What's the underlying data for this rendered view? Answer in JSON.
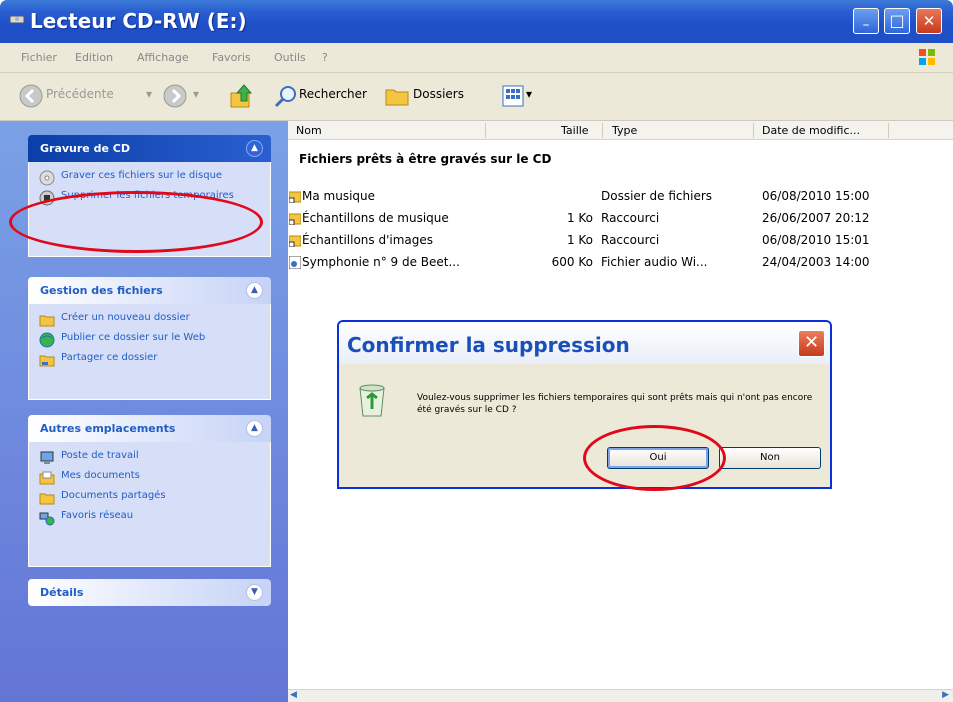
{
  "window": {
    "title": "Lecteur CD-RW (E:)",
    "minimize": "_",
    "maximize": "□",
    "close": "✕"
  },
  "menu": [
    "Fichier",
    "Edition",
    "Affichage",
    "Favoris",
    "Outils",
    "?"
  ],
  "toolbar": {
    "back": "Précédente",
    "search": "Rechercher",
    "folders": "Dossiers"
  },
  "left": {
    "cd_burning": {
      "title": "Gravure de CD",
      "items": [
        "Graver ces fichiers sur le disque",
        "Supprimer les fichiers temporaires"
      ]
    },
    "file_management": {
      "title": "Gestion des fichiers",
      "items": [
        "Créer un nouveau dossier",
        "Publier ce dossier sur le Web",
        "Partager ce dossier"
      ]
    },
    "other_places": {
      "title": "Autres emplacements",
      "items": [
        "Poste de travail",
        "Mes documents",
        "Documents partagés",
        "Favoris réseau"
      ]
    },
    "details": {
      "title": "Détails"
    }
  },
  "columns": [
    "Nom",
    "Taille",
    "Type",
    "Date de modific..."
  ],
  "group_header": "Fichiers prêts à être gravés sur le CD",
  "files": [
    {
      "name": "Ma musique",
      "size": "",
      "type": "Dossier de fichiers",
      "date": "06/08/2010 15:00"
    },
    {
      "name": "Échantillons de musique",
      "size": "1 Ko",
      "type": "Raccourci",
      "date": "26/06/2007 20:12"
    },
    {
      "name": "Échantillons d'images",
      "size": "1 Ko",
      "type": "Raccourci",
      "date": "06/08/2010 15:01"
    },
    {
      "name": "Symphonie n° 9 de Beet...",
      "size": "600 Ko",
      "type": "Fichier audio Wi...",
      "date": "24/04/2003 14:00"
    }
  ],
  "dialog": {
    "title": "Confirmer la suppression",
    "message": "Voulez-vous supprimer les fichiers temporaires qui sont prêts mais qui n'ont pas encore été gravés sur le CD ?",
    "yes": "Oui",
    "no": "Non",
    "close": "✕"
  },
  "colors": {
    "titlebar": "#2a5fd0",
    "annotation_ring": "#e0081a",
    "link": "#215dc6"
  }
}
